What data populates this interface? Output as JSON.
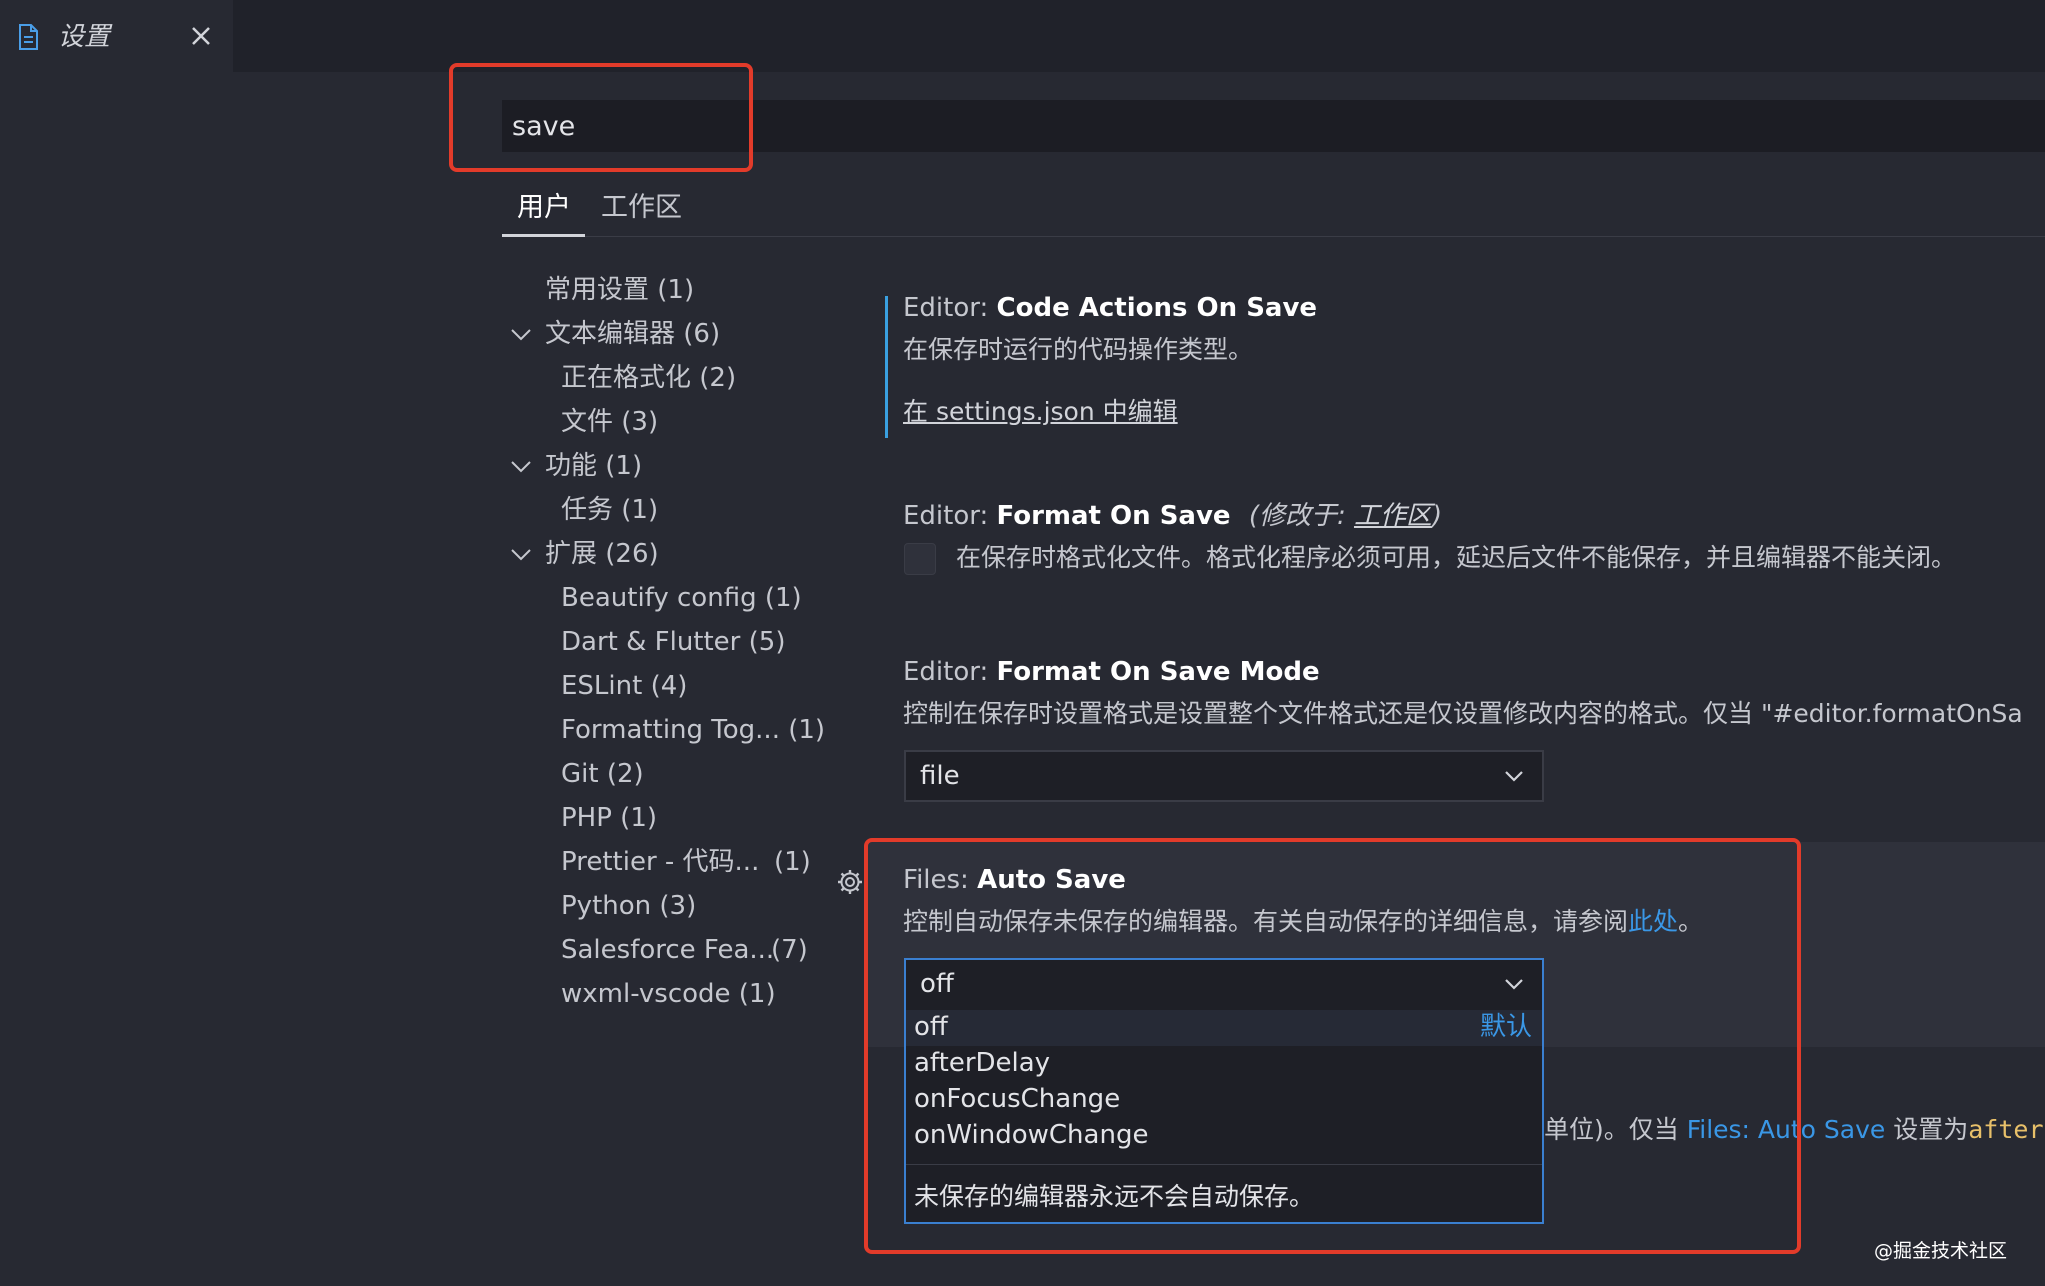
{
  "window": {
    "tab_title": "设置"
  },
  "search": {
    "value": "save"
  },
  "scope_tabs": [
    {
      "label": "用户"
    },
    {
      "label": "工作区"
    }
  ],
  "toc": [
    {
      "label": "常用设置 (1)"
    },
    {
      "label": "文本编辑器 (6)"
    },
    {
      "label": "正在格式化 (2)"
    },
    {
      "label": "文件 (3)"
    },
    {
      "label": "功能 (1)"
    },
    {
      "label": "任务 (1)"
    },
    {
      "label": "扩展 (26)"
    },
    {
      "label": "Beautify config (1)"
    },
    {
      "label": "Dart & Flutter (5)"
    },
    {
      "label": "ESLint (4)"
    },
    {
      "label": "Formatting Tog... (1)"
    },
    {
      "label": "Git (2)"
    },
    {
      "label": "PHP (1)"
    },
    {
      "label": "Prettier - 代码...",
      "count": "(1)"
    },
    {
      "label": "Python (3)"
    },
    {
      "label": "Salesforce Fea...",
      "count": "(7)"
    },
    {
      "label": "wxml-vscode (1)"
    }
  ],
  "settings": {
    "code_actions": {
      "category": "Editor:",
      "name": "Code Actions On Save",
      "description": "在保存时运行的代码操作类型。",
      "edit_link": "在 settings.json 中编辑"
    },
    "format_on_save": {
      "category": "Editor:",
      "name": "Format On Save",
      "modified_prefix": "(修改于: ",
      "modified_link": "工作区",
      "modified_suffix": ")",
      "description": "在保存时格式化文件。格式化程序必须可用，延迟后文件不能保存，并且编辑器不能关闭。"
    },
    "format_on_save_mode": {
      "category": "Editor:",
      "name": "Format On Save Mode",
      "description": "控制在保存时设置格式是设置整个文件格式还是仅设置修改内容的格式。仅当 \"#editor.formatOnSa",
      "value": "file"
    },
    "auto_save": {
      "category": "Files:",
      "name": "Auto Save",
      "description": "控制自动保存未保存的编辑器。有关自动保存的详细信息，请参阅",
      "description_link": "此处",
      "description_end": "。",
      "value": "off",
      "options": [
        "off",
        "afterDelay",
        "onFocusChange",
        "onWindowChange"
      ],
      "default_label": "默认",
      "option_description": "未保存的编辑器永远不会自动保存。"
    },
    "auto_save_delay": {
      "description_start": "单位)。仅当 ",
      "link": "Files: Auto Save",
      "middle": " 设置为",
      "code": "afterDel"
    }
  },
  "watermark": "@掘金技术社区",
  "colors": {
    "accent_blue": "#3a97e6",
    "highlight_red": "#e23b2a",
    "background": "#272932"
  }
}
